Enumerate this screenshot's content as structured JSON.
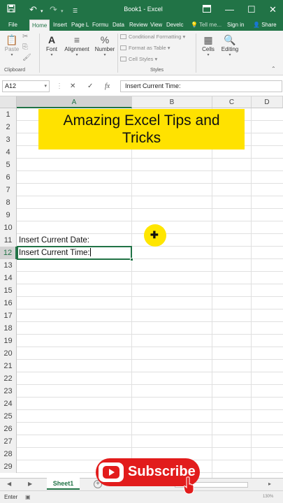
{
  "titlebar": {
    "title": "Book1 - Excel",
    "icons": [
      "save-icon",
      "undo-icon",
      "redo-icon",
      "customize-qat-icon",
      "ribbon-display-icon",
      "minimize-icon",
      "maximize-icon",
      "close-icon"
    ]
  },
  "tabs": [
    {
      "label": "File"
    },
    {
      "label": "Home"
    },
    {
      "label": "Insert"
    },
    {
      "label": "Page L"
    },
    {
      "label": "Formu"
    },
    {
      "label": "Data"
    },
    {
      "label": "Review"
    },
    {
      "label": "View"
    },
    {
      "label": "Develc"
    },
    {
      "label": "Tell me..."
    },
    {
      "label": "Sign in"
    },
    {
      "label": "Share"
    }
  ],
  "ribbon": {
    "paste_label": "Paste",
    "font_label": "Font",
    "alignment_label": "Alignment",
    "number_label": "Number",
    "conditional_formatting": "Conditional Formatting",
    "format_as_table": "Format as Table",
    "cell_styles": "Cell Styles",
    "cells_label": "Cells",
    "editing_label": "Editing",
    "clipboard_group": "Clipboard",
    "styles_group": "Styles"
  },
  "formula_bar": {
    "name_box": "A12",
    "formula": "Insert Current Time:"
  },
  "grid": {
    "columns": [
      "A",
      "B",
      "C",
      "D"
    ],
    "selected_column": "A",
    "selected_row": 12,
    "rows": [
      "1",
      "2",
      "3",
      "4",
      "5",
      "6",
      "7",
      "8",
      "9",
      "10",
      "11",
      "12",
      "13",
      "14",
      "15",
      "16",
      "17",
      "18",
      "19",
      "20",
      "21",
      "22",
      "23",
      "24",
      "25",
      "26",
      "27",
      "28",
      "29"
    ],
    "cells": {
      "A11": "Insert Current Date:",
      "A12": "Insert Current Time:"
    }
  },
  "banner": {
    "line1": "Amazing Excel Tips and",
    "line2": "Tricks",
    "color": "#ffe200"
  },
  "sheets": {
    "active": "Sheet1"
  },
  "status": {
    "mode": "Enter",
    "zoom": "130%"
  },
  "overlay": {
    "subscribe_label": "Subscribe"
  },
  "colors": {
    "excel_green": "#217346",
    "subscribe_red": "#e21c1c"
  }
}
